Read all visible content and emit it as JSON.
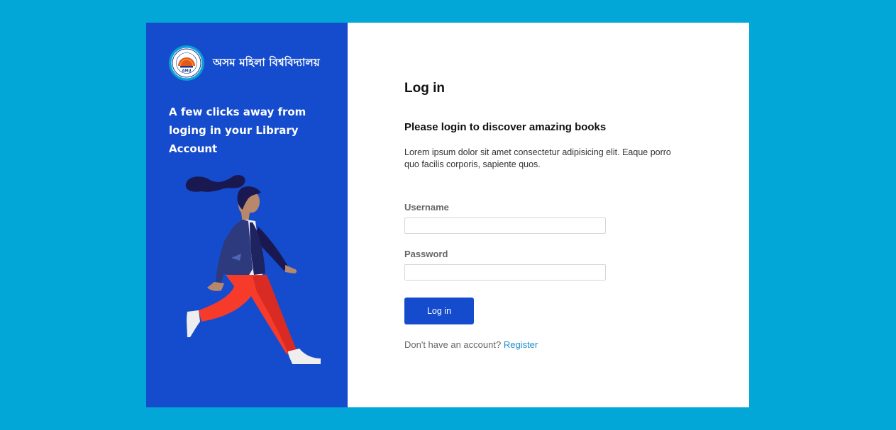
{
  "brand": {
    "name": "অসম মহিলা বিশ্ববিদ্যালয়",
    "logo_icon": "university-seal-icon",
    "logo_text": "AMU"
  },
  "tagline": "A few clicks away from loging in your Library Account",
  "illustration": {
    "icon": "walking-woman-illustration"
  },
  "login": {
    "title": "Log in",
    "subtitle": "Please login to discover amazing books",
    "description": "Lorem ipsum dolor sit amet consectetur adipisicing elit. Eaque porro quo facilis corporis, sapiente quos.",
    "username_label": "Username",
    "username_value": "",
    "password_label": "Password",
    "password_value": "",
    "button_label": "Log in",
    "register_prompt": "Don't have an account?",
    "register_link": "Register"
  },
  "colors": {
    "background": "#02a6d7",
    "panel_blue": "#154ccd",
    "button_blue": "#154ccd",
    "link": "#1b8fc8"
  }
}
